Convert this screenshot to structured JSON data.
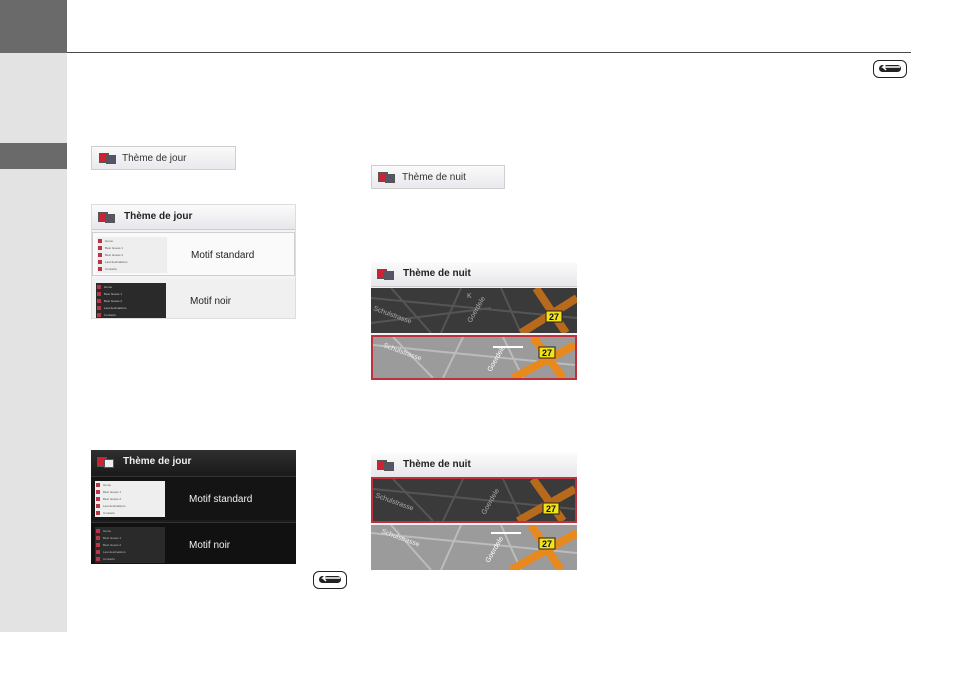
{
  "day_theme_label": "Thème de jour",
  "night_theme_label": "Thème de nuit",
  "option_standard": "Motif standard",
  "option_black": "Motif noir",
  "thumb_items": [
    "Home",
    "Best Guess 1",
    "Best Guess 2",
    "Last destinations",
    "Contacts"
  ],
  "route_number": "27",
  "street_a": "Schulstrasse",
  "street_b": "Goerdele",
  "street_c": "K",
  "colors": {
    "sidebar": "#e3e3e3",
    "tab": "#6a6a6a",
    "selection": "#c0303a",
    "road": "#e8891e",
    "route_sign": "#f2e21a"
  }
}
